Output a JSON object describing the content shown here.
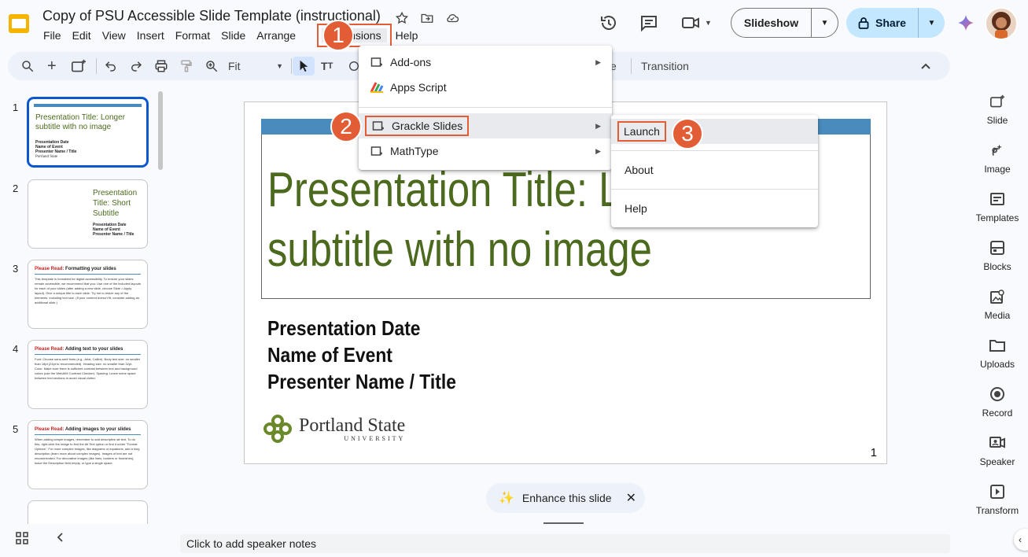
{
  "header": {
    "doc_title": "Copy of PSU Accessible Slide Template (instructional)",
    "menus": [
      "File",
      "Edit",
      "View",
      "Insert",
      "Format",
      "Slide",
      "Arrange",
      "Extensions",
      "Help"
    ],
    "slideshow_label": "Slideshow",
    "share_label": "Share"
  },
  "toolbar": {
    "zoom_label": "Fit",
    "theme_fragment": "e",
    "transition_label": "Transition"
  },
  "filmstrip": {
    "slides": [
      {
        "num": "1",
        "title": "Presentation Title: Longer subtitle with no image",
        "sub": [
          "Presentation Date",
          "Name of Event",
          "Presenter Name / Title"
        ],
        "logo": "Portland State"
      },
      {
        "num": "2",
        "title": "Presentation Title: Short Subtitle",
        "sub": [
          "Presentation Date",
          "Name of Event",
          "Presenter Name / Title"
        ]
      },
      {
        "num": "3",
        "head_bold": "Please Read:",
        "head": "Formatting your slides",
        "body": "This template is formatted for digital accessibility. To ensure your slides remain accessible, we recommend that you: Use one of the included layouts for each of your slides (after adding a new slide, choose Slide > Apply layout). Give a unique title to each slide. Try not to resize any of the elements, including text size. (If your content doesn't fit, consider adding an additional slide.)"
      },
      {
        "num": "4",
        "head_bold": "Please Read:",
        "head": "Adding text to your slides",
        "body": "Font: Choose sans-serif fonts (e.g., Arial, Calibri). Body text size: no smaller than 18pt (24pt to recommended). Heading size: no smaller than 32pt. Color: Make sure there is sufficient contrast between text and background colors (use the WebAIM Contrast Checker). Spacing: Leave some space between text sections to avoid visual clutter."
      },
      {
        "num": "5",
        "head_bold": "Please Read:",
        "head": "Adding images to your slides",
        "body": "When adding simple images, remember to add descriptive alt text. To do this, right-click the image to find the Alt Text option or find it under \"Format Options\". For more complex images, like diagrams or equations, add a long description (learn more about complex images). Images of text are not recommended. For decorative images (like lines, borders or flourishes), leave the Description field empty, or type a single space."
      }
    ]
  },
  "slide": {
    "title": "Presentation Title: Longer subtitle with no image",
    "title_line1": "Presentation Title: L",
    "title_line2": "subtitle with no image",
    "meta": [
      "Presentation Date",
      "Name of Event",
      "Presenter Name / Title"
    ],
    "logo_text": "Portland State",
    "logo_sub": "UNIVERSITY",
    "page_num": "1"
  },
  "extensions_menu": {
    "items": [
      {
        "label": "Add-ons",
        "icon": "addon-icon",
        "has_submenu": true
      },
      {
        "label": "Apps Script",
        "icon": "apps-script-icon",
        "has_submenu": false
      },
      {
        "label": "Grackle Slides",
        "icon": "addon-icon",
        "has_submenu": true
      },
      {
        "label": "MathType",
        "icon": "addon-icon",
        "has_submenu": true
      }
    ]
  },
  "grackle_submenu": {
    "items": [
      "Launch",
      "About",
      "Help"
    ]
  },
  "callouts": [
    "1",
    "2",
    "3"
  ],
  "right_rail": [
    "Slide",
    "Image",
    "Templates",
    "Blocks",
    "Media",
    "Uploads",
    "Record",
    "Speaker",
    "Transform"
  ],
  "bottom": {
    "enhance_label": "Enhance this slide",
    "notes_placeholder": "Click to add speaker notes"
  },
  "colors": {
    "accent_callout": "#e25c36",
    "title_green": "#4c6a1e",
    "slide_bar_blue": "#4a8bbd",
    "share_bg": "#c2e7ff"
  }
}
